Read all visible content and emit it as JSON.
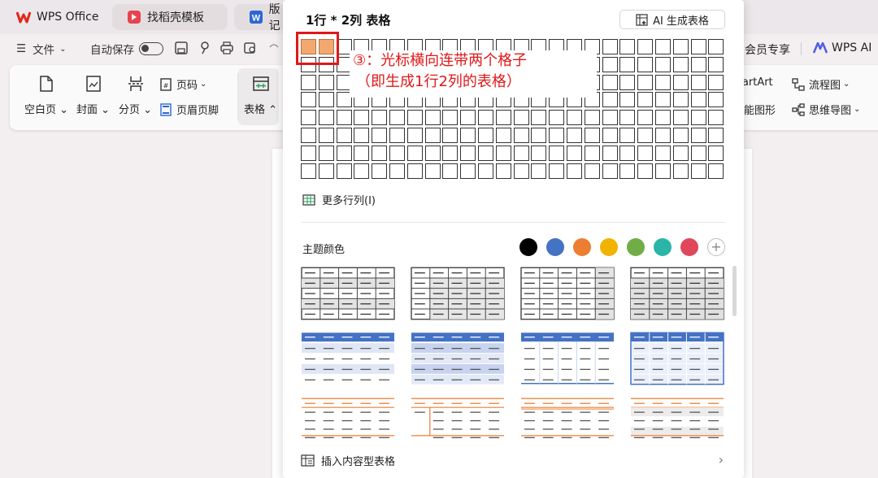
{
  "tabs": [
    {
      "label": "WPS Office"
    },
    {
      "label": "找稻壳模板"
    },
    {
      "label": "版记"
    }
  ],
  "menu": {
    "file": "文件",
    "autosave": "自动保存",
    "vip": "会员专享",
    "wps_ai": "WPS AI"
  },
  "ribbon": {
    "blank_page": "空白页",
    "cover": "封面",
    "page_break": "分页",
    "page_number": "页码",
    "header_footer": "页眉页脚",
    "table": "表格",
    "smartart": "SmartArt",
    "flowchart": "流程图",
    "smart_shape": "能图形",
    "mindmap": "思维导图"
  },
  "panel": {
    "title": "1行 * 2列 表格",
    "ai_button": "AI 生成表格",
    "more_rows_cols": "更多行列(I)",
    "theme_color_label": "主题颜色",
    "insert_content_table": "插入内容型表格",
    "grid_selection": {
      "rows": 1,
      "cols": 2
    },
    "grid_size": {
      "rows": 8,
      "cols": 24
    }
  },
  "annotation": {
    "line1": "③：光标横向连带两个格子",
    "line2": "（即生成1行2列的表格）",
    "color": "#e01818"
  },
  "theme_colors": [
    "#000000",
    "#4472c4",
    "#ed7d31",
    "#f0b400",
    "#70ad47",
    "#2bb5a8",
    "#e0475a"
  ],
  "colors": {
    "highlight_cell": "#f2a86f",
    "style_blue": "#4472c4",
    "style_orange": "#ed7d31"
  }
}
